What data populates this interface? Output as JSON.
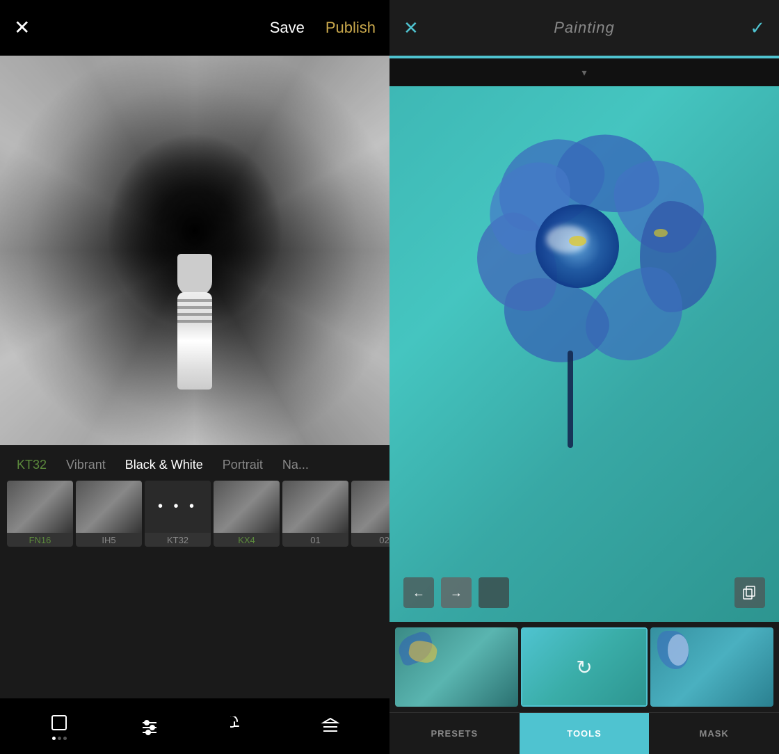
{
  "left": {
    "header": {
      "close_label": "✕",
      "save_label": "Save",
      "publish_label": "Publish"
    },
    "filter_categories": [
      {
        "id": "kt32",
        "label": "KT32",
        "state": "green"
      },
      {
        "id": "vibrant",
        "label": "Vibrant",
        "state": "normal"
      },
      {
        "id": "black_white",
        "label": "Black & White",
        "state": "active"
      },
      {
        "id": "portrait",
        "label": "Portrait",
        "state": "normal"
      },
      {
        "id": "natural",
        "label": "Na...",
        "state": "normal"
      }
    ],
    "filter_thumbnails": [
      {
        "id": "fn16",
        "label": "FN16",
        "label_state": "green"
      },
      {
        "id": "ih5",
        "label": "IH5",
        "label_state": "normal"
      },
      {
        "id": "kt32",
        "label": "KT32",
        "label_state": "normal",
        "is_dots": true
      },
      {
        "id": "kx4",
        "label": "KX4",
        "label_state": "green"
      },
      {
        "id": "01",
        "label": "01",
        "label_state": "normal"
      },
      {
        "id": "02",
        "label": "02",
        "label_state": "normal"
      }
    ],
    "bottom_toolbar": {
      "icons": [
        "frame",
        "sliders",
        "history",
        "layers"
      ]
    },
    "bw_filter_label": "Black White"
  },
  "right": {
    "header": {
      "close_label": "✕",
      "title": "Painting",
      "confirm_label": "✓"
    },
    "tabs": [
      {
        "id": "presets",
        "label": "PRESETS",
        "active": false
      },
      {
        "id": "tools",
        "label": "TOOLS",
        "active": true
      },
      {
        "id": "mask",
        "label": "MASK",
        "active": false
      }
    ],
    "nav": {
      "back_label": "←",
      "forward_label": "→"
    },
    "copy_icon_label": "⧉"
  }
}
